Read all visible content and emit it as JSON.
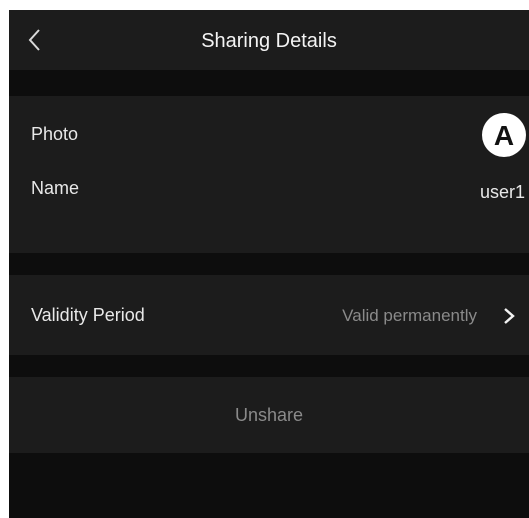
{
  "header": {
    "title": "Sharing Details"
  },
  "profile": {
    "photo_label": "Photo",
    "avatar_letter": "A",
    "name_label": "Name",
    "name_value": "user1"
  },
  "validity": {
    "label": "Validity Period",
    "value": "Valid permanently"
  },
  "actions": {
    "unshare_label": "Unshare"
  },
  "colors": {
    "background": "#0d0d0d",
    "section": "#1c1c1c",
    "text_primary": "#f2f2f2",
    "text_secondary": "#8a8a8a"
  },
  "icons": {
    "back": "chevron-left-icon",
    "navigate": "chevron-right-icon"
  }
}
